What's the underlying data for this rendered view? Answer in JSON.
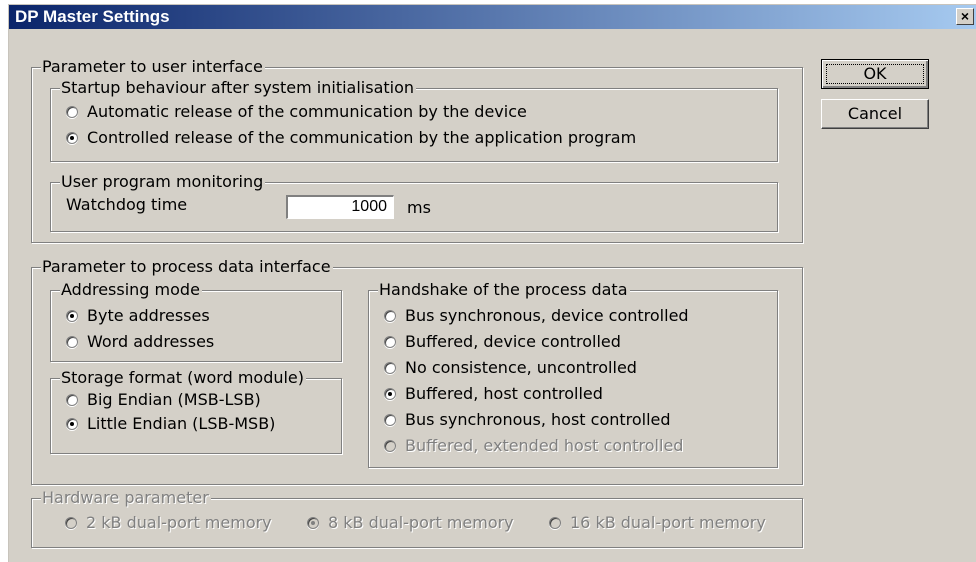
{
  "window": {
    "title": "DP Master Settings",
    "close_glyph": "×",
    "close_icon": "close-icon"
  },
  "buttons": {
    "ok_label": "OK",
    "cancel_label": "Cancel"
  },
  "user_interface": {
    "legend": "Parameter to user interface",
    "startup": {
      "legend": "Startup behaviour after system initialisation",
      "options": [
        {
          "label": "Automatic release of the communication by the device",
          "checked": false
        },
        {
          "label": "Controlled release of the communication by the application program",
          "checked": true
        }
      ]
    },
    "monitoring": {
      "legend": "User program monitoring",
      "watchdog_label": "Watchdog time",
      "watchdog_value": "1000",
      "unit": "ms"
    }
  },
  "process_data": {
    "legend": "Parameter to process data interface",
    "addressing": {
      "legend": "Addressing mode",
      "options": [
        {
          "label": "Byte addresses",
          "checked": true
        },
        {
          "label": "Word addresses",
          "checked": false
        }
      ]
    },
    "storage": {
      "legend": "Storage format (word module)",
      "options": [
        {
          "label": "Big Endian (MSB-LSB)",
          "checked": false
        },
        {
          "label": "Little Endian (LSB-MSB)",
          "checked": true
        }
      ]
    },
    "handshake": {
      "legend": "Handshake of the process data",
      "options": [
        {
          "label": "Bus synchronous, device controlled",
          "checked": false,
          "enabled": true
        },
        {
          "label": "Buffered, device controlled",
          "checked": false,
          "enabled": true
        },
        {
          "label": "No consistence, uncontrolled",
          "checked": false,
          "enabled": true
        },
        {
          "label": "Buffered, host controlled",
          "checked": true,
          "enabled": true
        },
        {
          "label": "Bus synchronous, host controlled",
          "checked": false,
          "enabled": true
        },
        {
          "label": "Buffered, extended host controlled",
          "checked": false,
          "enabled": false
        }
      ]
    }
  },
  "hardware": {
    "legend": "Hardware parameter",
    "options": [
      {
        "label": "2 kB dual-port memory",
        "checked": false,
        "enabled": false
      },
      {
        "label": "8 kB dual-port memory",
        "checked": true,
        "enabled": false
      },
      {
        "label": "16 kB dual-port memory",
        "checked": false,
        "enabled": false
      }
    ]
  },
  "colors": {
    "face": "#d4d0c8",
    "title_start": "#0a246a",
    "title_end": "#a6caf0",
    "disabled_text": "#808080"
  }
}
